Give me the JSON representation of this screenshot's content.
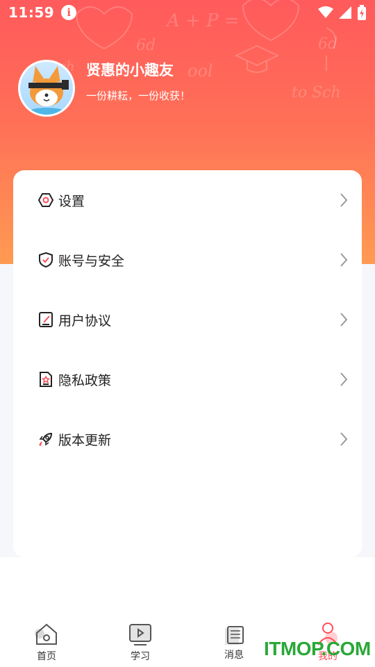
{
  "status_bar": {
    "time": "11:59",
    "info_glyph": "i"
  },
  "profile": {
    "nickname": "贤惠的小趣友",
    "motto": "一份耕耘，一份收获！"
  },
  "menu": [
    {
      "label": "设置",
      "icon": "settings-hexagon-icon"
    },
    {
      "label": "账号与安全",
      "icon": "shield-check-icon"
    },
    {
      "label": "用户协议",
      "icon": "document-edit-icon"
    },
    {
      "label": "隐私政策",
      "icon": "privacy-document-icon"
    },
    {
      "label": "版本更新",
      "icon": "rocket-icon"
    }
  ],
  "tabbar": [
    {
      "label": "首页",
      "icon": "home-icon"
    },
    {
      "label": "学习",
      "icon": "play-screen-icon"
    },
    {
      "label": "消息",
      "icon": "message-list-icon"
    },
    {
      "label": "我的",
      "icon": "user-icon",
      "active": true
    }
  ],
  "watermark": "ITMOP.COM",
  "colors": {
    "accent": "#ff5a5c",
    "header_bottom": "#ff9a52",
    "watermark": "#2aa838"
  }
}
